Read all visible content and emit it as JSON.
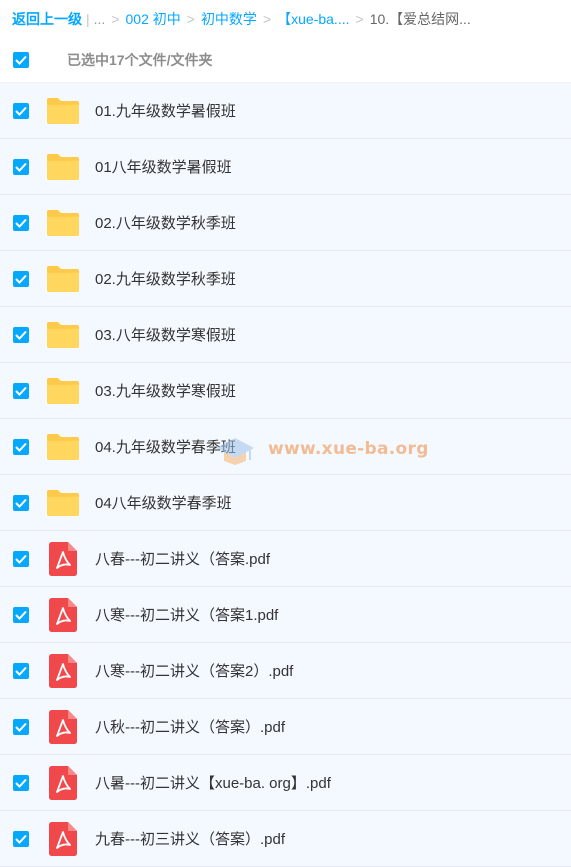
{
  "breadcrumb": {
    "back": "返回上一级",
    "pipe": "|",
    "ellipsis": "...",
    "sep": ">",
    "items": [
      "002 初中",
      "初中数学",
      "【xue-ba...."
    ],
    "current": "10.【爱总结网..."
  },
  "selection": {
    "label": "已选中17个文件/文件夹",
    "checked": true
  },
  "files": [
    {
      "name": "01.九年级数学暑假班",
      "type": "folder",
      "checked": true
    },
    {
      "name": "01八年级数学暑假班",
      "type": "folder",
      "checked": true
    },
    {
      "name": "02.八年级数学秋季班",
      "type": "folder",
      "checked": true
    },
    {
      "name": "02.九年级数学秋季班",
      "type": "folder",
      "checked": true
    },
    {
      "name": "03.八年级数学寒假班",
      "type": "folder",
      "checked": true
    },
    {
      "name": "03.九年级数学寒假班",
      "type": "folder",
      "checked": true
    },
    {
      "name": "04.九年级数学春季班",
      "type": "folder",
      "checked": true
    },
    {
      "name": "04八年级数学春季班",
      "type": "folder",
      "checked": true
    },
    {
      "name": "八春---初二讲义（答案.pdf",
      "type": "pdf",
      "checked": true
    },
    {
      "name": "八寒---初二讲义（答案1.pdf",
      "type": "pdf",
      "checked": true
    },
    {
      "name": "八寒---初二讲义（答案2）.pdf",
      "type": "pdf",
      "checked": true
    },
    {
      "name": "八秋---初二讲义（答案）.pdf",
      "type": "pdf",
      "checked": true
    },
    {
      "name": "八暑---初二讲义【xue-ba. org】.pdf",
      "type": "pdf",
      "checked": true
    },
    {
      "name": "九春---初三讲义（答案）.pdf",
      "type": "pdf",
      "checked": true
    }
  ],
  "watermark": {
    "text": "www.xue-ba.org"
  },
  "colors": {
    "accent": "#06a7ff",
    "folder": "#ffd64f",
    "pdf": "#f0484b",
    "row_bg": "#f4f8ff"
  },
  "icons": {
    "folder": "folder-icon",
    "pdf": "pdf-icon",
    "check": "checkmark-icon"
  }
}
